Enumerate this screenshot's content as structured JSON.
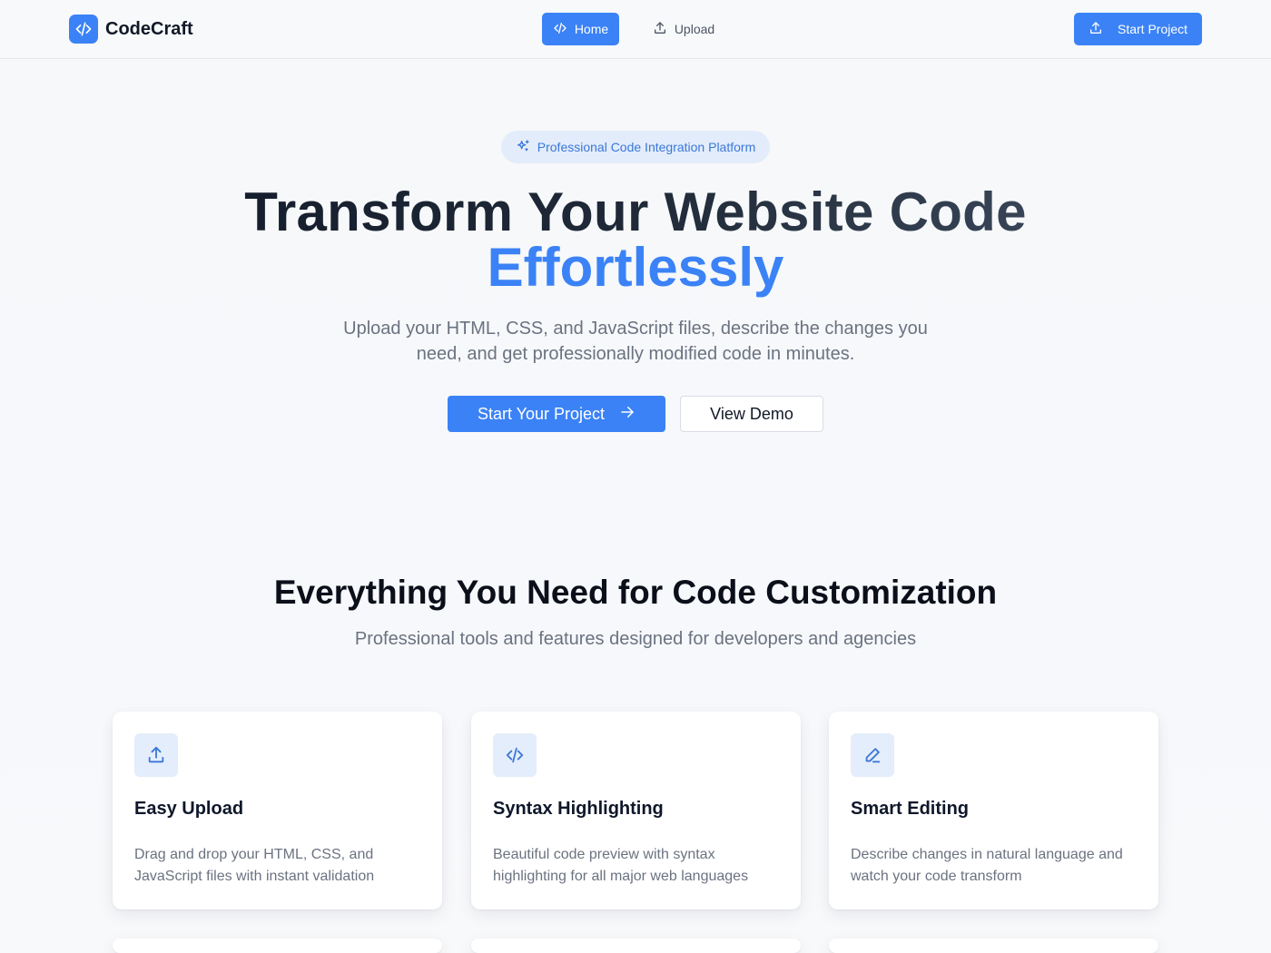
{
  "header": {
    "brand": "CodeCraft",
    "nav": [
      {
        "label": "Home",
        "icon": "code-icon",
        "active": true
      },
      {
        "label": "Upload",
        "icon": "upload-icon",
        "active": false
      }
    ],
    "cta_label": "Start Project"
  },
  "hero": {
    "badge": "Professional Code Integration Platform",
    "title_line1": "Transform Your Website Code",
    "title_line2": "Effortlessly",
    "subtitle": "Upload your HTML, CSS, and JavaScript files, describe the changes you need, and get professionally modified code in minutes.",
    "primary_button": "Start Your Project",
    "secondary_button": "View Demo"
  },
  "features": {
    "title": "Everything You Need for Code Customization",
    "subtitle": "Professional tools and features designed for developers and agencies",
    "cards": [
      {
        "icon": "upload-icon",
        "title": "Easy Upload",
        "description": "Drag and drop your HTML, CSS, and JavaScript files with instant validation"
      },
      {
        "icon": "code-icon",
        "title": "Syntax Highlighting",
        "description": "Beautiful code preview with syntax highlighting for all major web languages"
      },
      {
        "icon": "pencil-icon",
        "title": "Smart Editing",
        "description": "Describe changes in natural language and watch your code transform"
      }
    ]
  },
  "colors": {
    "accent": "#3b82f6",
    "badge_bg": "#e3ecfa",
    "icon_bg": "#e4edfb",
    "muted_text": "#6b7280"
  }
}
